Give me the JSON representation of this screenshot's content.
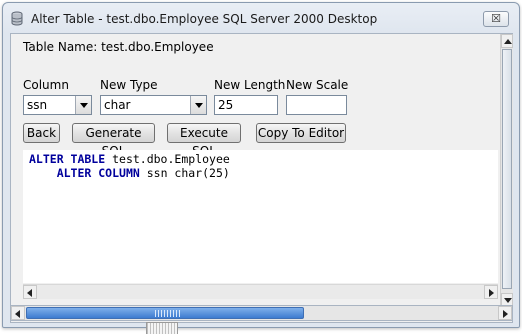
{
  "window": {
    "title": "Alter Table - test.dbo.Employee SQL Server 2000 Desktop",
    "close_label": "☒"
  },
  "table_name": "Table Name: test.dbo.Employee",
  "labels": {
    "column": "Column",
    "new_type": "New Type",
    "new_length": "New Length",
    "new_scale": "New Scale"
  },
  "fields": {
    "column_value": "ssn",
    "type_value": "char",
    "length_value": "25",
    "scale_value": ""
  },
  "buttons": {
    "back": "Back",
    "generate_sql": "Generate SQL",
    "execute_sql": "Execute SQL",
    "copy_to_editor": "Copy To Editor"
  },
  "sql": {
    "line1_kw": "ALTER TABLE",
    "line1_rest": " test.dbo.Employee",
    "line2_indent": "    ",
    "line2_kw": "ALTER COLUMN",
    "line2_rest": " ssn char(25)"
  },
  "colors": {
    "keyword": "#00009c",
    "scroll_thumb": "#3d7bd0"
  }
}
